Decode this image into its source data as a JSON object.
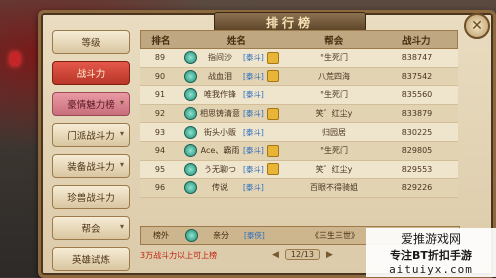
{
  "title": "排行榜",
  "close_icon": "close-icon",
  "sidebar": {
    "items": [
      {
        "label": "等级",
        "has_chevron": false
      },
      {
        "label": "战斗力",
        "has_chevron": false,
        "active": true
      },
      {
        "label": "豪情魅力榜",
        "has_chevron": true
      },
      {
        "label": "门派战斗力",
        "has_chevron": true
      },
      {
        "label": "装备战斗力",
        "has_chevron": true
      },
      {
        "label": "珍兽战斗力",
        "has_chevron": false
      },
      {
        "label": "帮会",
        "has_chevron": true
      },
      {
        "label": "英雄试炼",
        "has_chevron": false
      }
    ]
  },
  "table": {
    "headers": [
      "排名",
      "姓名",
      "帮会",
      "战斗力"
    ],
    "rows": [
      {
        "rank": "89",
        "name": "指间沙",
        "faction": "[泰斗]",
        "guild": "°生死门",
        "power": "838747",
        "medal": true
      },
      {
        "rank": "90",
        "name": "战血泪",
        "faction": "[泰斗]",
        "guild": "八荒四海",
        "power": "837542",
        "medal": true
      },
      {
        "rank": "91",
        "name": "唯我作锋",
        "faction": "[泰斗]",
        "guild": "°生死门",
        "power": "835560",
        "medal": false
      },
      {
        "rank": "92",
        "name": "相思铸清意",
        "faction": "[泰斗]",
        "guild": "笑゛红尘y",
        "power": "833879",
        "medal": true
      },
      {
        "rank": "93",
        "name": "街头小贩",
        "faction": "[泰斗]",
        "guild": "归园居",
        "power": "830225",
        "medal": false
      },
      {
        "rank": "94",
        "name": "Ace、霸雨",
        "faction": "[泰斗]",
        "guild": "°生死门",
        "power": "829805",
        "medal": true
      },
      {
        "rank": "95",
        "name": "う无聊つ",
        "faction": "[泰斗]",
        "guild": "笑゛红尘y",
        "power": "829553",
        "medal": true
      },
      {
        "rank": "96",
        "name": "传说",
        "faction": "[泰斗]",
        "guild": "百眼不得骑姐",
        "power": "829226",
        "medal": false
      }
    ],
    "my_row": {
      "rank": "榜外",
      "name": "亲分",
      "faction": "[泰侠]",
      "guild": "《三生三世》",
      "power": ""
    }
  },
  "footer_note": "3万战斗力以上可上榜",
  "pager": {
    "text": "12/13"
  },
  "watermark": {
    "line1": "爱推游戏网",
    "line2": "专注BT折扣手游",
    "line3": "aituiyx.com"
  }
}
